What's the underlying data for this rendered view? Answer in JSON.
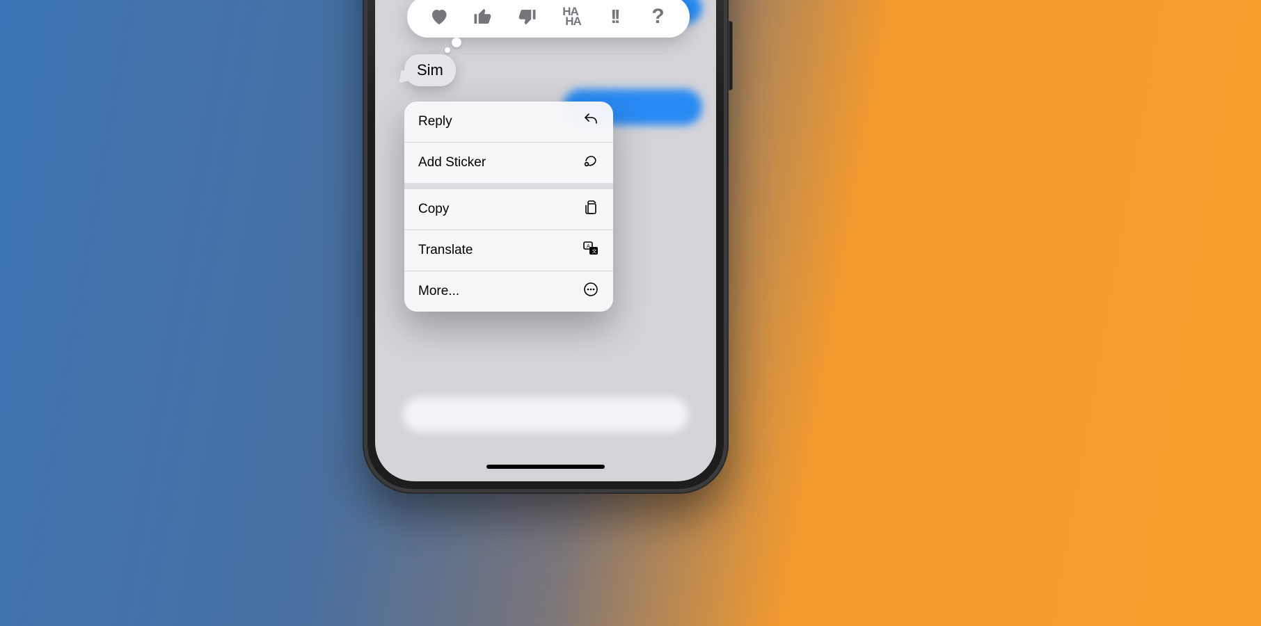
{
  "tapback": {
    "heart_label": "heart",
    "like_label": "thumbs-up",
    "dislike_label": "thumbs-down",
    "haha_top": "HA",
    "haha_bottom": "HA",
    "emphasize": "!!",
    "question": "?"
  },
  "selected_message": {
    "text": "Sim"
  },
  "context_menu": {
    "reply": "Reply",
    "add_sticker": "Add Sticker",
    "copy": "Copy",
    "translate": "Translate",
    "more": "More..."
  }
}
